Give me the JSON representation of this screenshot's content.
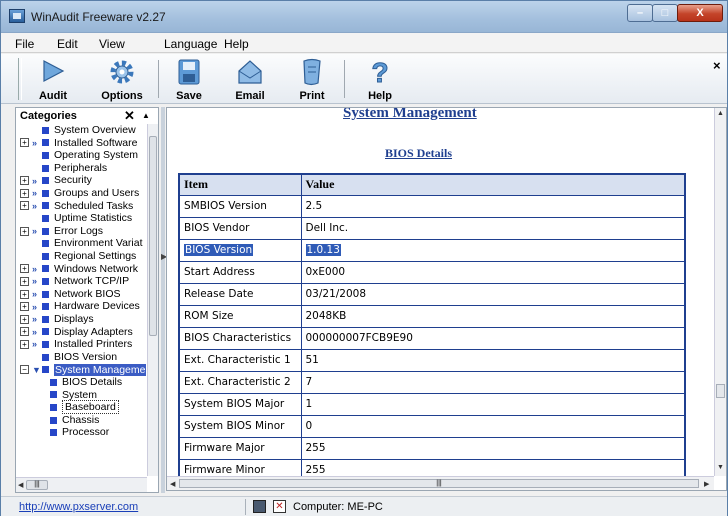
{
  "window": {
    "title": "WinAudit Freeware v2.27",
    "min_glyph": "–",
    "max_glyph": "□",
    "close_glyph": "X"
  },
  "menu": [
    {
      "label": "File"
    },
    {
      "label": "Edit"
    },
    {
      "label": "View"
    },
    {
      "label": "Language"
    },
    {
      "label": "Help"
    }
  ],
  "toolbar": {
    "audit": "Audit",
    "options": "Options",
    "save": "Save",
    "email": "Email",
    "print": "Print",
    "help": "Help",
    "close_glyph": "×"
  },
  "categories": {
    "header": "Categories",
    "close_glyph": "✕",
    "items": [
      {
        "label": "System Overview",
        "expander": false,
        "arrow": false
      },
      {
        "label": "Installed Software",
        "expander": true,
        "arrow": true
      },
      {
        "label": "Operating System",
        "expander": false,
        "arrow": false
      },
      {
        "label": "Peripherals",
        "expander": false,
        "arrow": false
      },
      {
        "label": "Security",
        "expander": true,
        "arrow": true
      },
      {
        "label": "Groups and Users",
        "expander": true,
        "arrow": true
      },
      {
        "label": "Scheduled Tasks",
        "expander": true,
        "arrow": true
      },
      {
        "label": "Uptime Statistics",
        "expander": false,
        "arrow": false
      },
      {
        "label": "Error Logs",
        "expander": true,
        "arrow": true
      },
      {
        "label": "Environment Variat",
        "expander": false,
        "arrow": false
      },
      {
        "label": "Regional Settings",
        "expander": false,
        "arrow": false
      },
      {
        "label": "Windows Network",
        "expander": true,
        "arrow": true
      },
      {
        "label": "Network TCP/IP",
        "expander": true,
        "arrow": true
      },
      {
        "label": "Network BIOS",
        "expander": true,
        "arrow": true
      },
      {
        "label": "Hardware Devices",
        "expander": true,
        "arrow": true
      },
      {
        "label": "Displays",
        "expander": true,
        "arrow": true
      },
      {
        "label": "Display Adapters",
        "expander": true,
        "arrow": true
      },
      {
        "label": "Installed Printers",
        "expander": true,
        "arrow": true
      },
      {
        "label": "BIOS Version",
        "expander": false,
        "arrow": false
      },
      {
        "label": "System Manageme",
        "expander": true,
        "arrow": true,
        "selected": true
      },
      {
        "label": "BIOS Details",
        "child": true
      },
      {
        "label": "System",
        "child": true
      },
      {
        "label": "Baseboard",
        "child": true,
        "focused": true
      },
      {
        "label": "Chassis",
        "child": true
      },
      {
        "label": "Processor",
        "child": true
      }
    ]
  },
  "content": {
    "section_title": "System Management",
    "table_title": "BIOS Details",
    "columns": [
      "Item",
      "Value"
    ],
    "rows": [
      {
        "item": "SMBIOS Version",
        "value": "2.5"
      },
      {
        "item": "BIOS Vendor",
        "value": "Dell Inc."
      },
      {
        "item": "BIOS Version",
        "value": "1.0.13",
        "highlight": true
      },
      {
        "item": "Start Address",
        "value": "0xE000"
      },
      {
        "item": "Release Date",
        "value": "03/21/2008"
      },
      {
        "item": "ROM Size",
        "value": "2048KB"
      },
      {
        "item": "BIOS Characteristics",
        "value": "000000007FCB9E90"
      },
      {
        "item": "Ext. Characteristic 1",
        "value": "51"
      },
      {
        "item": "Ext. Characteristic 2",
        "value": "7"
      },
      {
        "item": "System BIOS Major",
        "value": "1"
      },
      {
        "item": "System BIOS Minor",
        "value": "0"
      },
      {
        "item": "Firmware Major",
        "value": "255"
      },
      {
        "item": "Firmware Minor",
        "value": "255"
      }
    ]
  },
  "status": {
    "link": "http://www.pxserver.com",
    "computer": "Computer: ME-PC"
  },
  "colors": {
    "accent": "#1f3f8f",
    "selection": "#2f5bb7",
    "tree_bullet": "#2646c8"
  }
}
